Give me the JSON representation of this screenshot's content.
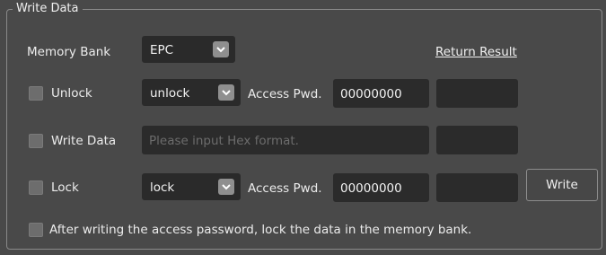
{
  "group": {
    "title": "Write Data"
  },
  "memory_bank": {
    "label": "Memory Bank",
    "selected": "EPC"
  },
  "return_result": {
    "label": "Return Result"
  },
  "unlock_row": {
    "checkbox_label": "Unlock",
    "selected": "unlock",
    "pwd_label": "Access Pwd.",
    "pwd_value": "00000000",
    "result": ""
  },
  "write_row": {
    "checkbox_label": "Write Data",
    "placeholder": "Please input Hex format.",
    "result": ""
  },
  "lock_row": {
    "checkbox_label": "Lock",
    "selected": "lock",
    "pwd_label": "Access Pwd.",
    "pwd_value": "00000000",
    "result": "",
    "button": "Write"
  },
  "footer": {
    "checkbox_label": "After writing the access password, lock the data in the memory bank."
  },
  "icons": {
    "dropdown": "chevron-down-icon"
  }
}
